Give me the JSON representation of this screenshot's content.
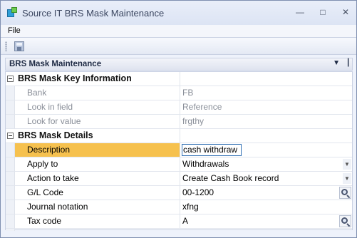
{
  "window": {
    "title": "Source IT BRS Mask Maintenance"
  },
  "menu": {
    "file": "File"
  },
  "panel": {
    "title": "BRS Mask Maintenance",
    "dropdown_glyph": "▼",
    "pin_glyph": "📌"
  },
  "grid": {
    "categories": {
      "key_info": "BRS Mask Key Information",
      "details": "BRS Mask Details"
    },
    "key_rows": [
      {
        "label": "Bank",
        "value": "FB"
      },
      {
        "label": "Look in field",
        "value": "Reference"
      },
      {
        "label": "Look for value",
        "value": "frgthy"
      }
    ],
    "detail_rows": [
      {
        "label": "Description",
        "value": "cash withdraw"
      },
      {
        "label": "Apply to",
        "value": "Withdrawals"
      },
      {
        "label": "Action to take",
        "value": "Create Cash Book record"
      },
      {
        "label": "G/L Code",
        "value": "00-1200"
      },
      {
        "label": "Journal notation",
        "value": "xfng"
      },
      {
        "label": "Tax code",
        "value": "A"
      }
    ]
  },
  "colors": {
    "selected_row": "#f6c14e",
    "accent": "#2f6fb4"
  }
}
